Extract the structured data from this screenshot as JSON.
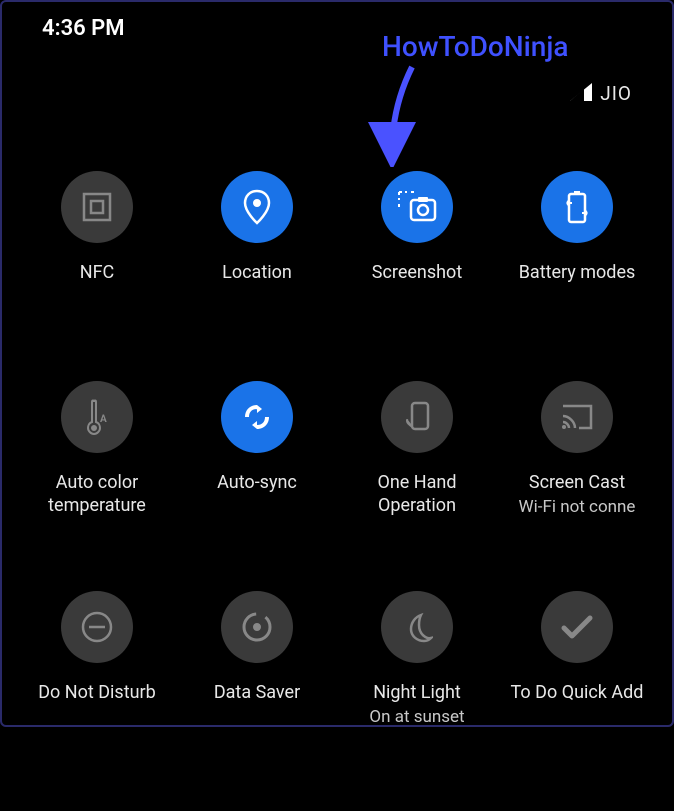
{
  "status": {
    "time": "4:36 PM",
    "carrier": "JIO"
  },
  "annotation": {
    "watermark": "HowToDoNinja"
  },
  "tiles": [
    {
      "label": "NFC",
      "sublabel": "",
      "active": false,
      "icon": "nfc"
    },
    {
      "label": "Location",
      "sublabel": "",
      "active": true,
      "icon": "location"
    },
    {
      "label": "Screenshot",
      "sublabel": "",
      "active": true,
      "icon": "screenshot"
    },
    {
      "label": "Battery modes",
      "sublabel": "",
      "active": true,
      "icon": "battery"
    },
    {
      "label": "Auto color temperature",
      "sublabel": "",
      "active": false,
      "icon": "thermo"
    },
    {
      "label": "Auto-sync",
      "sublabel": "",
      "active": true,
      "icon": "sync"
    },
    {
      "label": "One Hand Operation",
      "sublabel": "",
      "active": false,
      "icon": "onehand"
    },
    {
      "label": "Screen Cast",
      "sublabel": "Wi-Fi not conne",
      "active": false,
      "icon": "cast"
    },
    {
      "label": "Do Not Disturb",
      "sublabel": "",
      "active": false,
      "icon": "dnd"
    },
    {
      "label": "Data Saver",
      "sublabel": "",
      "active": false,
      "icon": "datasaver"
    },
    {
      "label": "Night Light",
      "sublabel": "On at sunset",
      "active": false,
      "icon": "night"
    },
    {
      "label": "To Do Quick Add",
      "sublabel": "",
      "active": false,
      "icon": "todo"
    }
  ]
}
